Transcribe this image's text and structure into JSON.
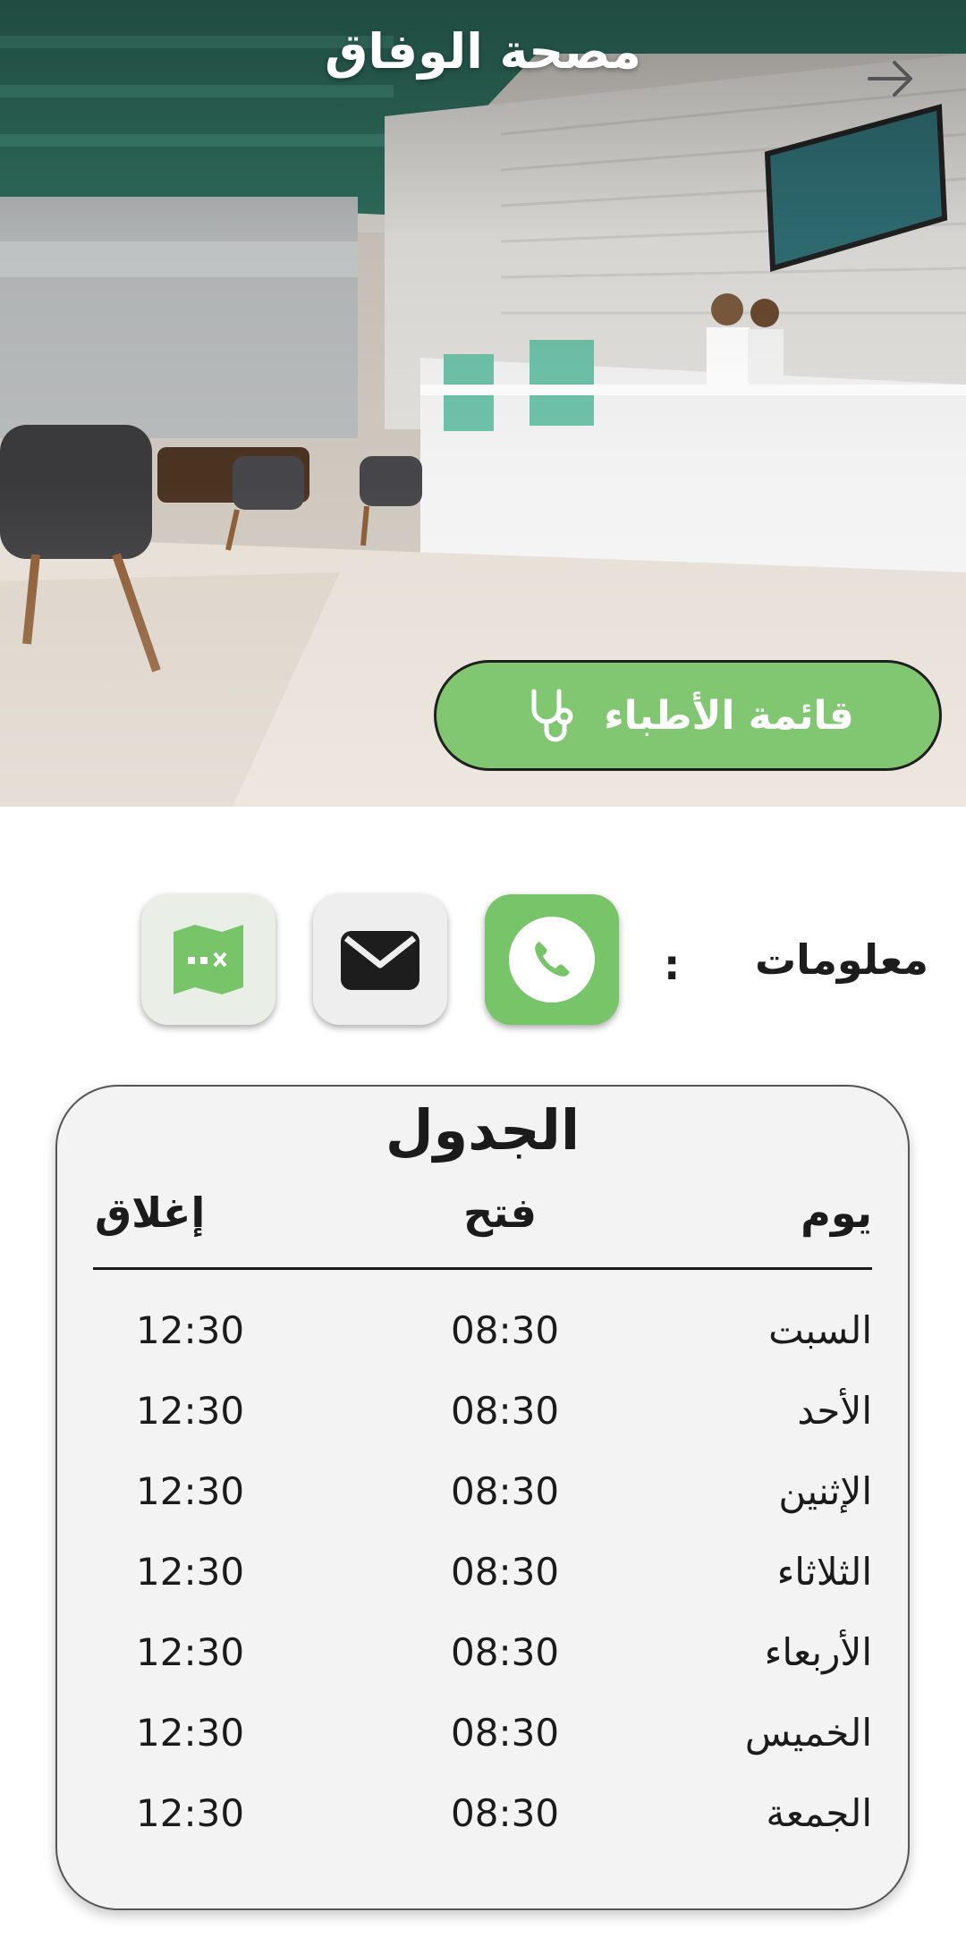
{
  "header": {
    "title": "مصحة الوفاق"
  },
  "hero": {
    "doctors_button_label": "قائمة الأطباء"
  },
  "info": {
    "label": "معلومات",
    "separator": ":",
    "contacts": [
      {
        "icon": "phone-icon",
        "color": "#78c468"
      },
      {
        "icon": "mail-icon",
        "color": "#eeeeee"
      },
      {
        "icon": "map-icon",
        "color": "#e9eee7"
      }
    ]
  },
  "schedule": {
    "title": "الجدول",
    "headers": {
      "day": "يوم",
      "open": "فتح",
      "close": "إغلاق"
    },
    "rows": [
      {
        "day": "السبت",
        "open": "08:30",
        "close": "12:30"
      },
      {
        "day": "الأحد",
        "open": "08:30",
        "close": "12:30"
      },
      {
        "day": "الإثنين",
        "open": "08:30",
        "close": "12:30"
      },
      {
        "day": "الثلاثاء",
        "open": "08:30",
        "close": "12:30"
      },
      {
        "day": "الأربعاء",
        "open": "08:30",
        "close": "12:30"
      },
      {
        "day": "الخميس",
        "open": "08:30",
        "close": "12:30"
      },
      {
        "day": "الجمعة",
        "open": "08:30",
        "close": "12:30"
      }
    ]
  },
  "colors": {
    "accent_green": "#78c468",
    "ceiling_teal": "#2f6f5f"
  }
}
